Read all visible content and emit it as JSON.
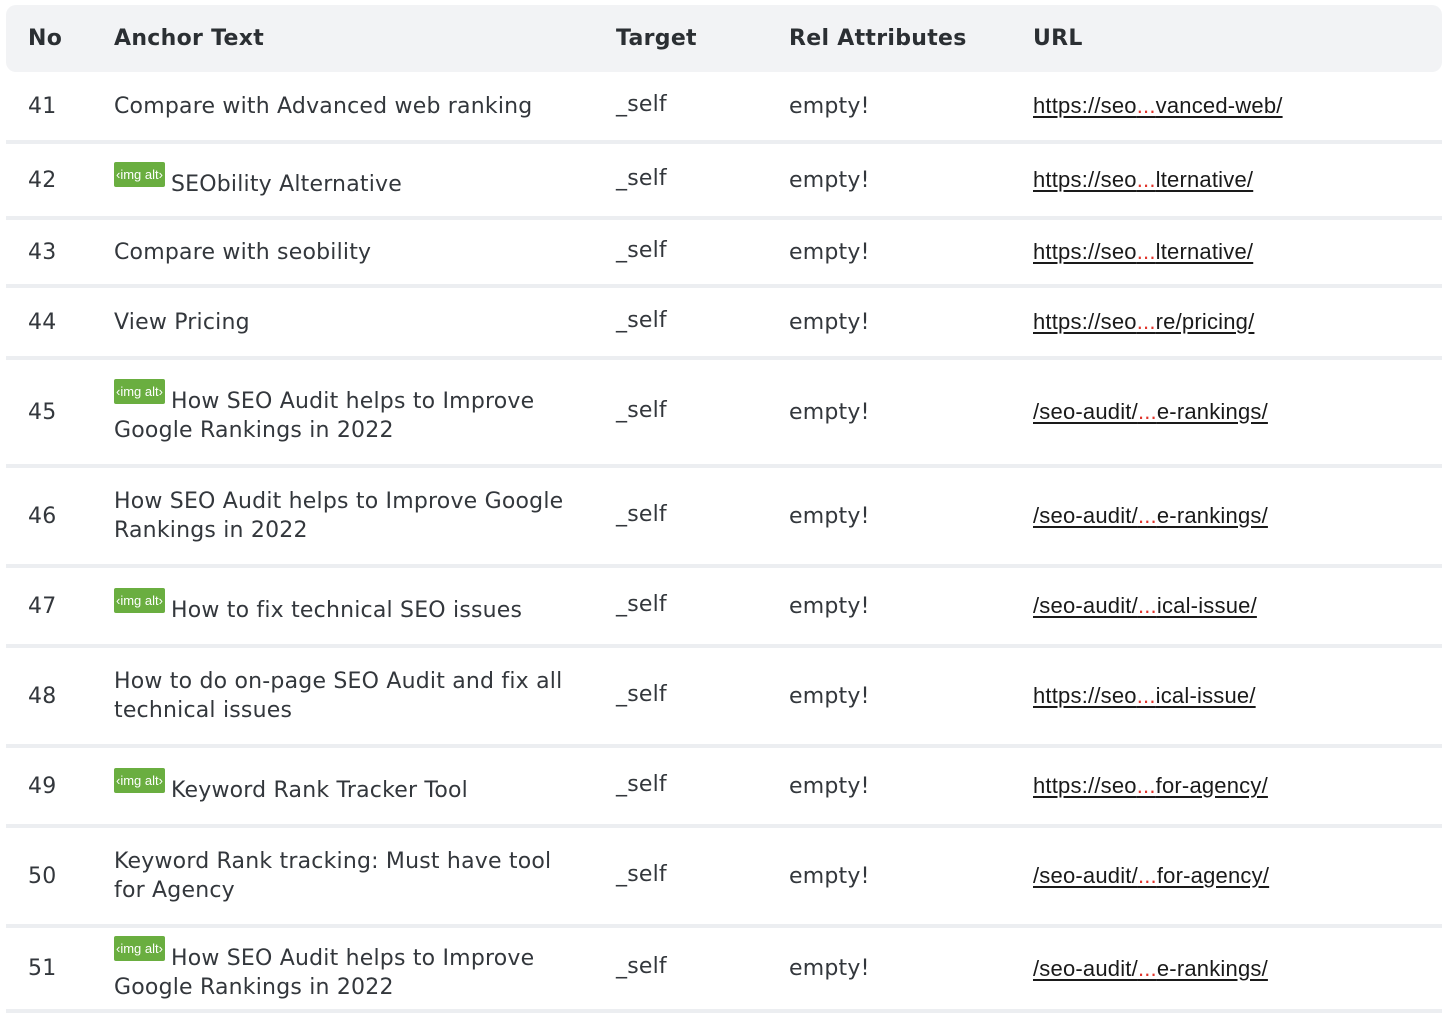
{
  "table": {
    "headers": {
      "no": "No",
      "anchor": "Anchor Text",
      "target": "Target",
      "rel": "Rel Attributes",
      "url": "URL"
    },
    "badge_label": "‹img alt›",
    "rows": [
      {
        "no": "41",
        "badge": false,
        "anchor": "Compare with Advanced web ranking",
        "target": "_self",
        "rel": "empty!",
        "url_start": "https://seo",
        "url_ellipsis": "...",
        "url_end": "vanced-web/"
      },
      {
        "no": "42",
        "badge": true,
        "anchor": "SEObility Alternative",
        "target": "_self",
        "rel": "empty!",
        "url_start": "https://seo",
        "url_ellipsis": "...",
        "url_end": "lternative/"
      },
      {
        "no": "43",
        "badge": false,
        "anchor": "Compare with seobility",
        "target": "_self",
        "rel": "empty!",
        "url_start": "https://seo",
        "url_ellipsis": "...",
        "url_end": "lternative/"
      },
      {
        "no": "44",
        "badge": false,
        "anchor": "View Pricing",
        "target": "_self",
        "rel": "empty!",
        "url_start": "https://seo",
        "url_ellipsis": "...",
        "url_end": "re/pricing/"
      },
      {
        "no": "45",
        "badge": true,
        "anchor": "How SEO Audit helps to Improve Google Rankings in 2022",
        "target": "_self",
        "rel": "empty!",
        "url_start": "/seo-audit/",
        "url_ellipsis": "...",
        "url_end": "e-rankings/"
      },
      {
        "no": "46",
        "badge": false,
        "anchor": "How SEO Audit helps to Improve Google Rankings in 2022",
        "target": "_self",
        "rel": "empty!",
        "url_start": "/seo-audit/",
        "url_ellipsis": "...",
        "url_end": "e-rankings/"
      },
      {
        "no": "47",
        "badge": true,
        "anchor": "How to fix technical SEO issues",
        "target": "_self",
        "rel": "empty!",
        "url_start": "/seo-audit/",
        "url_ellipsis": "...",
        "url_end": "ical-issue/"
      },
      {
        "no": "48",
        "badge": false,
        "anchor": "How to do on-page SEO Audit and fix all technical issues",
        "target": "_self",
        "rel": "empty!",
        "url_start": "https://seo",
        "url_ellipsis": "...",
        "url_end": "ical-issue/"
      },
      {
        "no": "49",
        "badge": true,
        "anchor": "Keyword Rank Tracker Tool",
        "target": "_self",
        "rel": "empty!",
        "url_start": "https://seo",
        "url_ellipsis": "...",
        "url_end": "for-agency/"
      },
      {
        "no": "50",
        "badge": false,
        "anchor": "Keyword Rank tracking: Must have tool for Agency",
        "target": "_self",
        "rel": "empty!",
        "url_start": "/seo-audit/",
        "url_ellipsis": "...",
        "url_end": "for-agency/"
      },
      {
        "no": "51",
        "badge": true,
        "anchor": "How SEO Audit helps to Improve Google Rankings in 2022",
        "target": "_self",
        "rel": "empty!",
        "url_start": "/seo-audit/",
        "url_ellipsis": "...",
        "url_end": "e-rankings/"
      }
    ]
  },
  "colors": {
    "header_bg": "#f2f3f5",
    "badge_bg": "#6aae40",
    "ellipsis": "#e0342b",
    "row_divider": "#eceef1"
  }
}
